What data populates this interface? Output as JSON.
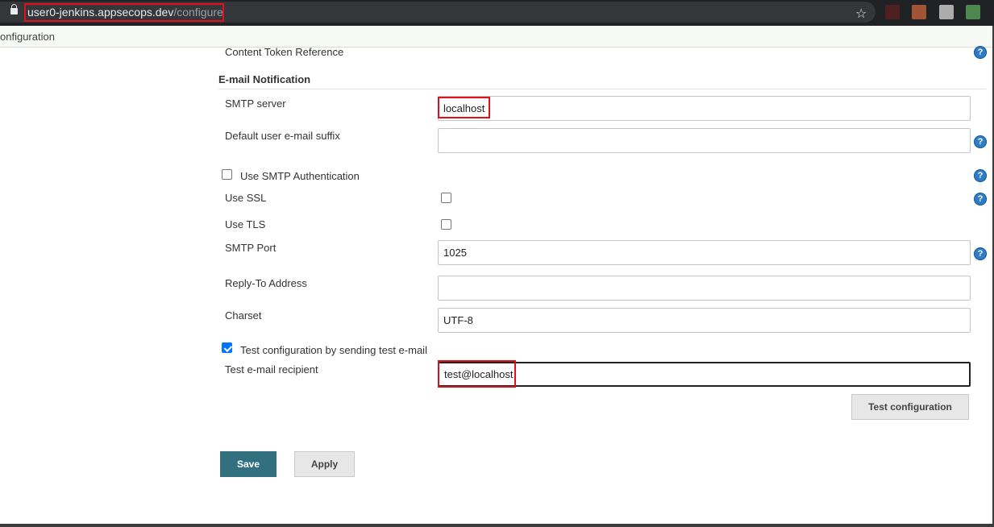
{
  "browser": {
    "url_host": "user0-jenkins.appsecops.dev",
    "url_path": "/configure"
  },
  "breadcrumb": "onfiguration",
  "extended_email": {
    "content_token_label": "Content Token Reference"
  },
  "email_notification": {
    "title": "E-mail Notification",
    "smtp_server_label": "SMTP server",
    "smtp_server_value": "localhost",
    "default_suffix_label": "Default user e-mail suffix",
    "default_suffix_value": "",
    "use_smtp_auth_label": "Use SMTP Authentication",
    "use_smtp_auth_checked": false,
    "use_ssl_label": "Use SSL",
    "use_ssl_checked": false,
    "use_tls_label": "Use TLS",
    "use_tls_checked": false,
    "smtp_port_label": "SMTP Port",
    "smtp_port_value": "1025",
    "reply_to_label": "Reply-To Address",
    "reply_to_value": "",
    "charset_label": "Charset",
    "charset_value": "UTF-8",
    "test_config_label": "Test configuration by sending test e-mail",
    "test_config_checked": true,
    "test_recipient_label": "Test e-mail recipient",
    "test_recipient_value": "test@localhost",
    "test_button": "Test configuration"
  },
  "actions": {
    "save": "Save",
    "apply": "Apply"
  },
  "help_icon_glyph": "?",
  "colors": {
    "save_button": "#33707f",
    "help_icon": "#2e7cc4",
    "annotation_red": "#e0101a"
  }
}
